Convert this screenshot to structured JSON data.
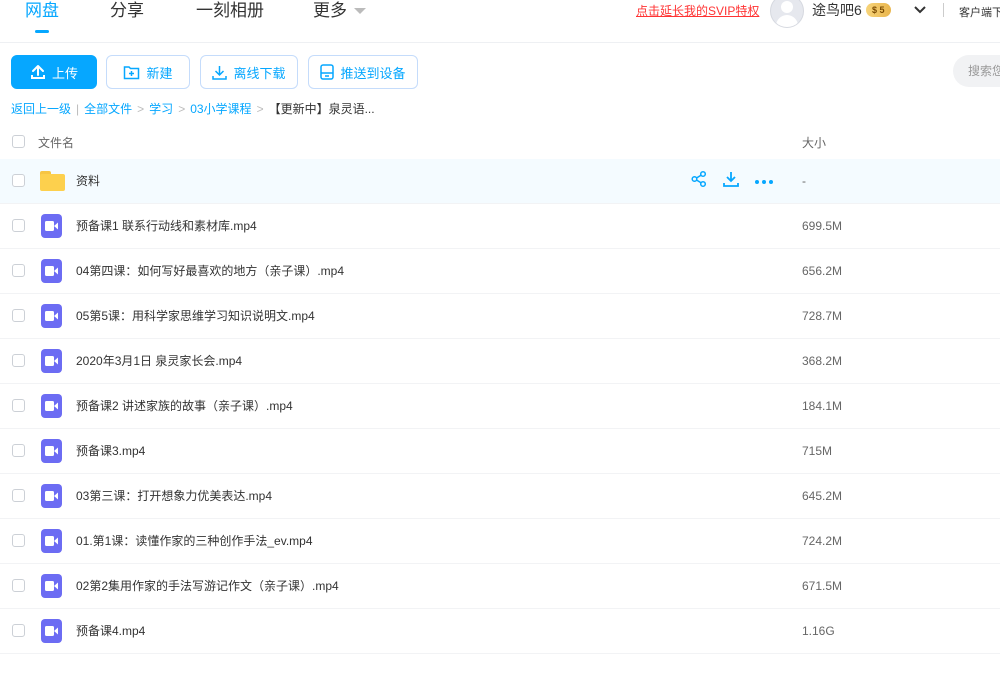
{
  "nav": {
    "tabs": [
      {
        "label": "网盘"
      },
      {
        "label": "分享"
      },
      {
        "label": "一刻相册"
      },
      {
        "label": "更多"
      }
    ],
    "svip_link": "点击延长我的SVIP特权",
    "username": "途鸟吧6",
    "vip_level": "$ 5",
    "client_label": "客户端下"
  },
  "toolbar": {
    "upload": "上传",
    "new": "新建",
    "offline_download": "离线下载",
    "push_to_device": "推送到设备",
    "search_placeholder": "搜索您"
  },
  "breadcrumb": {
    "back": "返回上一级",
    "items": [
      "全部文件",
      "学习",
      "03小学课程"
    ],
    "current": "【更新中】泉灵语..."
  },
  "table": {
    "col_name": "文件名",
    "col_size": "大小",
    "rows": [
      {
        "name": "资料",
        "size": "-",
        "type": "folder"
      },
      {
        "name": "预备课1 联系行动线和素材库.mp4",
        "size": "699.5M",
        "type": "video"
      },
      {
        "name": "04第四课：如何写好最喜欢的地方（亲子课）.mp4",
        "size": "656.2M",
        "type": "video"
      },
      {
        "name": "05第5课：用科学家思维学习知识说明文.mp4",
        "size": "728.7M",
        "type": "video"
      },
      {
        "name": "2020年3月1日 泉灵家长会.mp4",
        "size": "368.2M",
        "type": "video"
      },
      {
        "name": "预备课2 讲述家族的故事（亲子课）.mp4",
        "size": "184.1M",
        "type": "video"
      },
      {
        "name": "预备课3.mp4",
        "size": "715M",
        "type": "video"
      },
      {
        "name": "03第三课：打开想象力优美表达.mp4",
        "size": "645.2M",
        "type": "video"
      },
      {
        "name": "01.第1课：读懂作家的三种创作手法_ev.mp4",
        "size": "724.2M",
        "type": "video"
      },
      {
        "name": "02第2集用作家的手法写游记作文（亲子课）.mp4",
        "size": "671.5M",
        "type": "video"
      },
      {
        "name": "预备课4.mp4",
        "size": "1.16G",
        "type": "video"
      }
    ]
  },
  "colors": {
    "accent": "#06a7ff",
    "video_icon": "#6c6cf3",
    "folder": "#fdd04d",
    "svip_link": "#ff3333"
  }
}
